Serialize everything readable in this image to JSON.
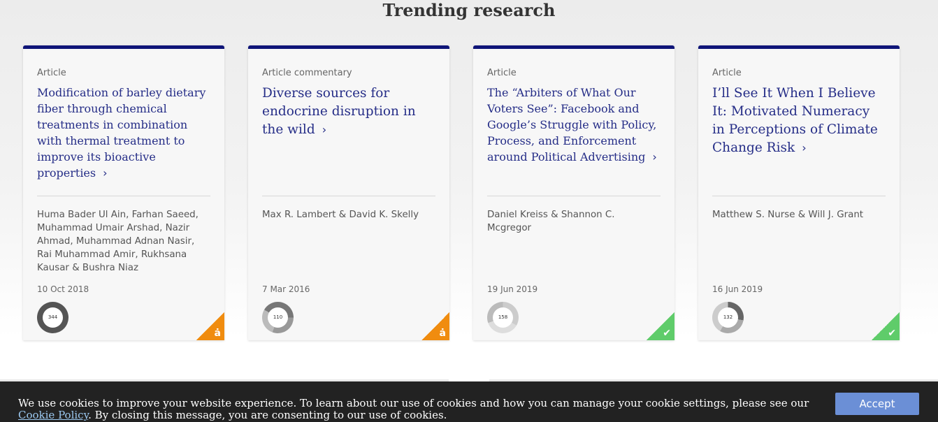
{
  "section": {
    "title": "Trending research"
  },
  "cards": [
    {
      "type": "Article",
      "title": "Modification of barley dietary fiber through chemical treatments in combination with thermal treatment to improve its bioactive properties",
      "authors_main": "Huma Bader Ul Ain, Farhan Saeed, Muhammad Umair Arshad, Nazir Ahmad, Muhammad Adnan Nasir, Rai Muhammad Amir, Rukhsana Kausar",
      "authors_last": "Bushra Niaz",
      "date": "10 Oct 2018",
      "altmetric": "344",
      "access": "open-access"
    },
    {
      "type": "Article commentary",
      "title": "Diverse sources for endocrine disruption in the wild",
      "authors_main": "Max R. Lambert",
      "authors_last": "David K. Skelly",
      "date": "7 Mar 2016",
      "altmetric": "110",
      "access": "open-access"
    },
    {
      "type": "Article",
      "title": "The “Arbiters of What Our Voters See”: Facebook and Google’s Struggle with Policy, Process, and Enforcement around Political Advertising",
      "authors_main": "Daniel Kreiss",
      "authors_last": "Shannon C. Mcgregor",
      "date": "19 Jun 2019",
      "altmetric": "158",
      "access": "free-access"
    },
    {
      "type": "Article",
      "title": "I’ll See It When I Believe It: Motivated Numeracy in Perceptions of Climate Change Risk",
      "authors_main": "Matthew S. Nurse",
      "authors_last": "Will J. Grant",
      "date": "16 Jun 2019",
      "altmetric": "132",
      "access": "free-access"
    }
  ],
  "author_sep": " & ",
  "badges": {
    "open_access_symbol": "ȧ",
    "free_access_symbol": "✔"
  },
  "icons": {
    "chevron": "›"
  },
  "cookie": {
    "text_before": "We use cookies to improve your website experience. To learn about our use of cookies and how you can manage your cookie settings, please see our ",
    "link_label": "Cookie Policy",
    "text_after": ". By closing this message, you are consenting to our use of cookies.",
    "accept_label": "Accept"
  },
  "colors": {
    "accent_navy": "#0f1578",
    "title_link": "#252d87",
    "open_access": "#f08c0f",
    "free_access": "#5fcc6a",
    "cookie_button": "#6b8fd6"
  }
}
